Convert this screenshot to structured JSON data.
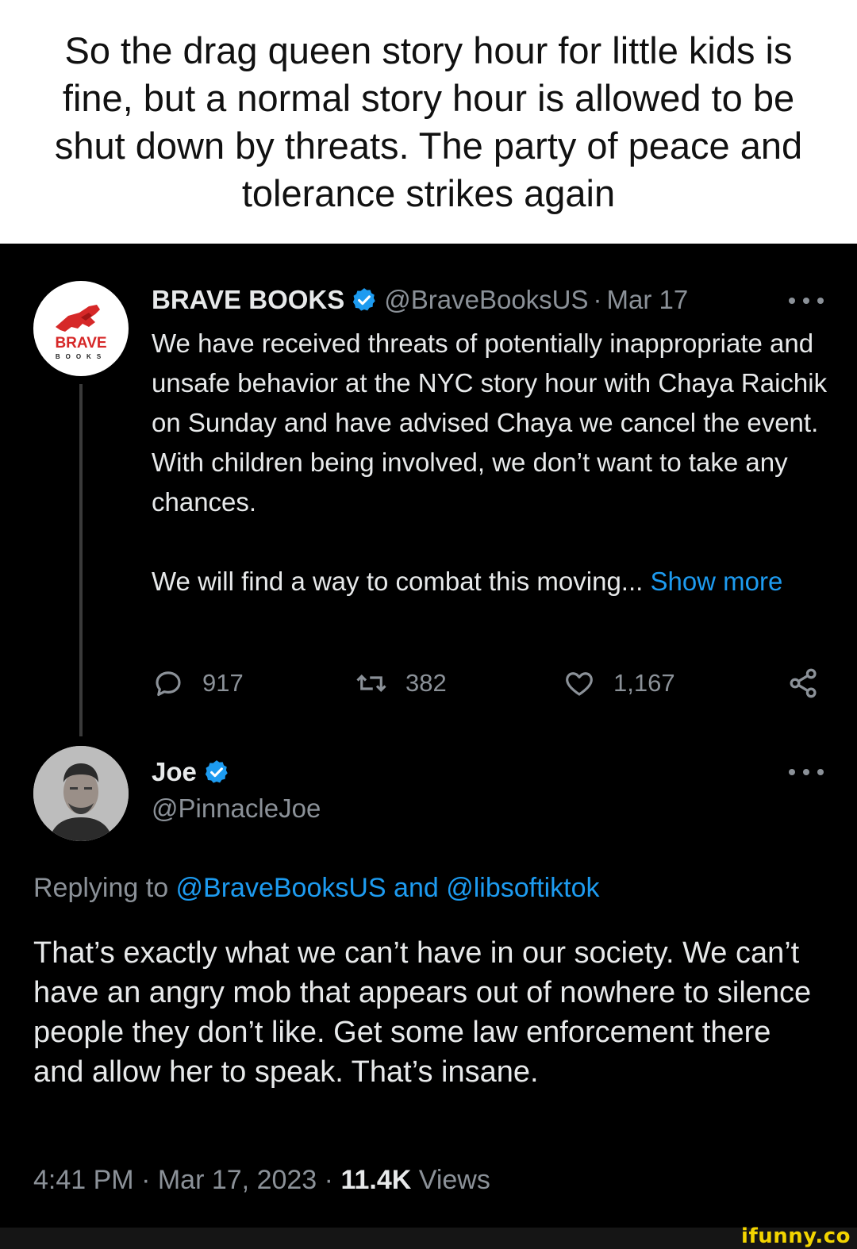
{
  "caption": {
    "text": "So the drag queen story hour for little kids is fine, but a normal story hour is allowed to be shut down by threats. The party of peace and tolerance strikes again"
  },
  "original_tweet": {
    "display_name": "BRAVE BOOKS",
    "handle": "@BraveBooksUS",
    "separator": "·",
    "date": "Mar 17",
    "avatar_logo_text": "BRAVE",
    "avatar_logo_subtext": "BOOKS",
    "body_line1": "We have received threats of potentially inappropriate and unsafe behavior at the NYC story hour with Chaya Raichik on Sunday and have advised Chaya we cancel the event. With children being involved, we don’t want to take any chances.",
    "body_line2": "We will find a way to combat this moving... ",
    "show_more": "Show more",
    "stats": {
      "replies": "917",
      "retweets": "382",
      "likes": "1,167"
    }
  },
  "reply_tweet": {
    "display_name": "Joe",
    "handle": "@PinnacleJoe",
    "replying_prefix": "Replying to ",
    "replying_handle_1": "@BraveBooksUS",
    "replying_and": " and ",
    "replying_handle_2": "@libsoftiktok",
    "body": "That’s exactly what we can’t have in our society. We can’t have an angry mob that appears out of nowhere to silence people they don’t like. Get some law enforcement there and allow her to speak. That’s insane.",
    "time": "4:41 PM",
    "date": "Mar 17, 2023",
    "separator": "·",
    "views_count": "11.4K",
    "views_label": "Views"
  },
  "watermark": "ifunny.co",
  "colors": {
    "background": "#000000",
    "link": "#1d9bf0",
    "muted": "#8b9198",
    "verified": "#1d9bf0",
    "brand_red": "#d62828",
    "watermark": "#f2d400"
  },
  "icons": [
    "verified-badge-icon",
    "more-icon",
    "reply-icon",
    "retweet-icon",
    "like-icon",
    "share-icon"
  ]
}
